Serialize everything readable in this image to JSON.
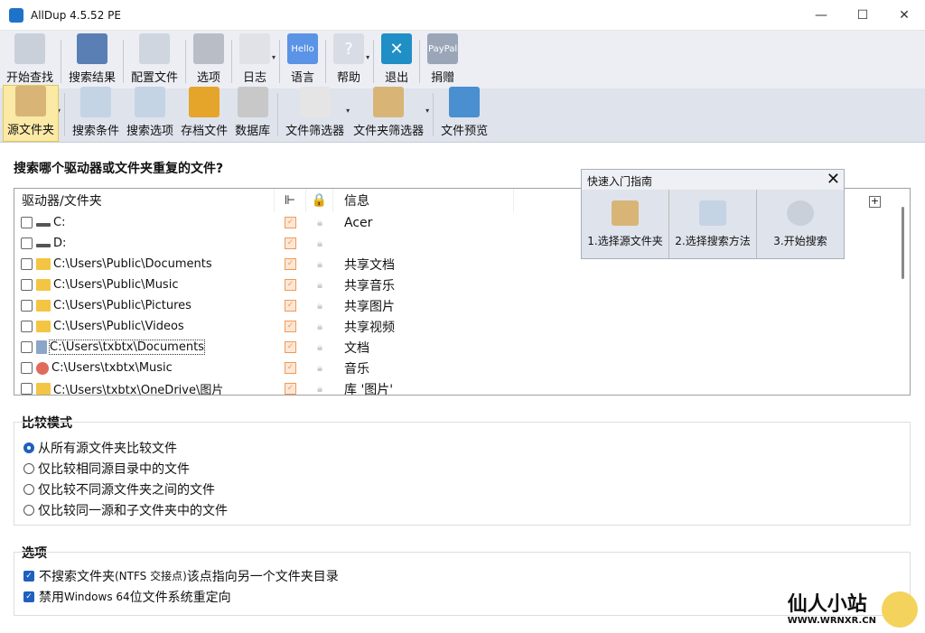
{
  "window": {
    "title": "AllDup 4.5.52 PE",
    "minimize": "—",
    "maximize": "☐",
    "close": "✕"
  },
  "toolbar1": [
    {
      "label": "开始查找",
      "icon": "magnifier-icon",
      "color": "#c9d0da"
    },
    {
      "label": "搜索结果",
      "icon": "save-results-icon",
      "color": "#5a7fb5"
    },
    {
      "label": "配置文件",
      "icon": "config-file-icon",
      "color": "#cfd6e0"
    },
    {
      "label": "选项",
      "icon": "options-icon",
      "color": "#b9bec6"
    },
    {
      "label": "日志",
      "icon": "log-icon",
      "color": "#e0e2e8",
      "dropdown": true
    },
    {
      "label": "语言",
      "icon": "language-icon",
      "color": "#5b93e6",
      "text": "Hello"
    },
    {
      "label": "帮助",
      "icon": "help-icon",
      "color": "#d8dde5",
      "text": "?",
      "dropdown": true
    },
    {
      "label": "退出",
      "icon": "exit-icon",
      "color": "#1f8fc6",
      "text": "✕"
    },
    {
      "label": "捐赠",
      "icon": "paypal-icon",
      "color": "#9aa6b8",
      "text": "PayPal"
    }
  ],
  "toolbar2": [
    {
      "label": "源文件夹",
      "icon": "source-folder-icon",
      "color": "#d8b577",
      "dropdown": true,
      "active": true
    },
    {
      "label": "搜索条件",
      "icon": "search-criteria-icon",
      "color": "#c5d4e4"
    },
    {
      "label": "搜索选项",
      "icon": "search-options-icon",
      "color": "#c5d4e4"
    },
    {
      "label": "存档文件",
      "icon": "archive-icon",
      "color": "#e5a52b"
    },
    {
      "label": "数据库",
      "icon": "database-icon",
      "color": "#c8c8c8"
    },
    {
      "label": "文件筛选器",
      "icon": "file-filter-icon",
      "color": "#e5e5e5",
      "dropdown": true
    },
    {
      "label": "文件夹筛选器",
      "icon": "folder-filter-icon",
      "color": "#d8b577",
      "dropdown": true
    },
    {
      "label": "文件预览",
      "icon": "file-preview-icon",
      "color": "#4a8fd0"
    }
  ],
  "main": {
    "heading": "搜索哪个驱动器或文件夹重复的文件?",
    "columns": {
      "path": "驱动器/文件夹",
      "info": "信息"
    },
    "rows": [
      {
        "path": "C:",
        "info": "Acer",
        "icon": "drive-icon"
      },
      {
        "path": "D:",
        "info": "",
        "icon": "drive-icon"
      },
      {
        "path": "C:\\Users\\Public\\Documents",
        "info": "共享文档",
        "icon": "folder-icon"
      },
      {
        "path": "C:\\Users\\Public\\Music",
        "info": "共享音乐",
        "icon": "folder-icon"
      },
      {
        "path": "C:\\Users\\Public\\Pictures",
        "info": "共享图片",
        "icon": "folder-icon"
      },
      {
        "path": "C:\\Users\\Public\\Videos",
        "info": "共享视频",
        "icon": "folder-icon"
      },
      {
        "path": "C:\\Users\\txbtx\\Documents",
        "info": "文档",
        "icon": "documents-icon"
      },
      {
        "path": "C:\\Users\\txbtx\\Music",
        "info": "音乐",
        "icon": "music-icon"
      },
      {
        "path": "C:\\Users\\txbtx\\OneDrive\\图片",
        "info": "库 '图片'",
        "icon": "folder-icon"
      }
    ]
  },
  "guide": {
    "title": "快速入门指南",
    "close": "✕",
    "steps": [
      "1.选择源文件夹",
      "2.选择搜索方法",
      "3.开始搜索"
    ]
  },
  "compare": {
    "title": "比较模式",
    "options": [
      "从所有源文件夹比较文件",
      "仅比较相同源目录中的文件",
      "仅比较不同源文件夹之间的文件",
      "仅比较同一源和子文件夹中的文件"
    ],
    "selected": 0
  },
  "options": {
    "title": "选项",
    "items": [
      {
        "pre": "不搜索文件夹 ",
        "small": "(NTFS 交接点)",
        "post": " 该点指向另一个文件夹目录",
        "checked": true
      },
      {
        "pre": "禁用 ",
        "small": "Windows 64",
        "post": " 位文件系统重定向",
        "checked": true
      }
    ]
  },
  "watermark": {
    "title": "仙人小站",
    "url": "WWW.WRNXR.CN"
  }
}
